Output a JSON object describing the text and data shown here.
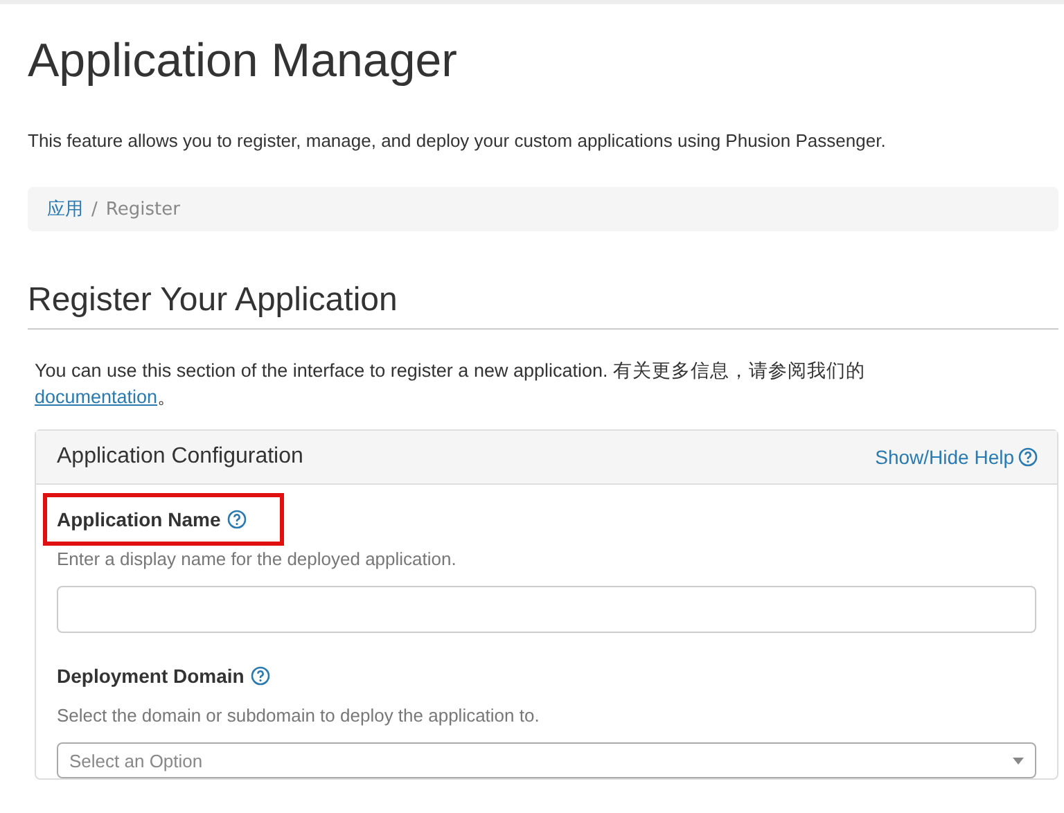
{
  "page": {
    "title": "Application Manager",
    "description": "This feature allows you to register, manage, and deploy your custom applications using Phusion Passenger."
  },
  "breadcrumb": {
    "separator": "/",
    "items": [
      {
        "label": "应用",
        "link": true
      },
      {
        "label": "Register",
        "link": false
      }
    ]
  },
  "section": {
    "title": "Register Your Application",
    "intro": "You can use this section of the interface to register a new application. 有关更多信息，请参阅我们的",
    "intro_link": "documentation",
    "intro_end": "。"
  },
  "panel": {
    "title": "Application Configuration",
    "help_link": "Show/Hide Help",
    "fields": [
      {
        "kind": "text",
        "label": "Application Name",
        "help": "Enter a display name for the deployed application.",
        "highlighted": true
      },
      {
        "kind": "select",
        "label": "Deployment Domain",
        "help": "Select the domain or subdomain to deploy the application to.",
        "placeholder": "Select an Option",
        "highlighted": false
      }
    ]
  }
}
